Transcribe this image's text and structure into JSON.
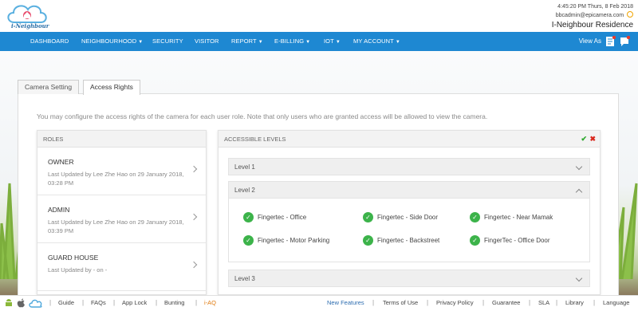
{
  "header": {
    "logo_text": "i-Neighbour",
    "datetime": "4:45:20 PM  Thurs, 8 Feb 2018",
    "user_email": "bbcadmin@epicamera.com",
    "site_name": "I-Neighbour Residence"
  },
  "nav": {
    "items": [
      {
        "label": "DASHBOARD",
        "dropdown": false
      },
      {
        "label": "NEIGHBOURHOOD",
        "dropdown": true
      },
      {
        "label": "SECURITY",
        "dropdown": false
      },
      {
        "label": "VISITOR",
        "dropdown": false
      },
      {
        "label": "REPORT",
        "dropdown": true
      },
      {
        "label": "E-BILLING",
        "dropdown": true
      },
      {
        "label": "IOT",
        "dropdown": true
      },
      {
        "label": "MY ACCOUNT",
        "dropdown": true
      }
    ],
    "caret": "▼",
    "view_as_label": "View As",
    "icons": [
      "document-icon",
      "chat-icon"
    ],
    "bar_color": "#1e88d2"
  },
  "tabs": [
    {
      "label": "Camera Setting",
      "active": false
    },
    {
      "label": "Access Rights",
      "active": true
    }
  ],
  "info_text": "You may configure the access rights of the camera for each user role. Note that only users who are granted access will be allowed to view the camera.",
  "roles": {
    "header": "ROLES",
    "items": [
      {
        "name": "OWNER",
        "updated": "Last Updated by Lee Zhe Hao on 29 January 2018, 03:28 PM"
      },
      {
        "name": "ADMIN",
        "updated": "Last Updated by Lee Zhe Hao on 29 January 2018, 03:39 PM"
      },
      {
        "name": "GUARD HOUSE",
        "updated": "Last Updated by - on -"
      }
    ]
  },
  "levels": {
    "header": "ACCESSIBLE LEVELS",
    "save_glyph": "✔",
    "cancel_glyph": "✖",
    "items": [
      {
        "label": "Level 1",
        "expanded": false
      },
      {
        "label": "Level 2",
        "expanded": true
      },
      {
        "label": "Level 3",
        "expanded": false
      }
    ],
    "level2_cameras": [
      "Fingertec - Office",
      "Fingertec - Side Door",
      "Fingertec - Near Mamak",
      "Fingertec - Motor Parking",
      "Fingertec - Backstreet",
      "FingerTec - Office Door"
    ],
    "check_glyph": "✓",
    "check_color": "#3cb34a"
  },
  "footer": {
    "left_links": [
      "Guide",
      "FAQs",
      "App Lock",
      "Bunting",
      "i-AQ"
    ],
    "right_links": [
      "New Features",
      "Terms of Use",
      "Privacy Policy",
      "Guarantee",
      "SLA",
      "Library",
      "Language"
    ],
    "separator": "|",
    "icons": [
      "android-icon",
      "apple-icon",
      "cloud-icon"
    ]
  }
}
